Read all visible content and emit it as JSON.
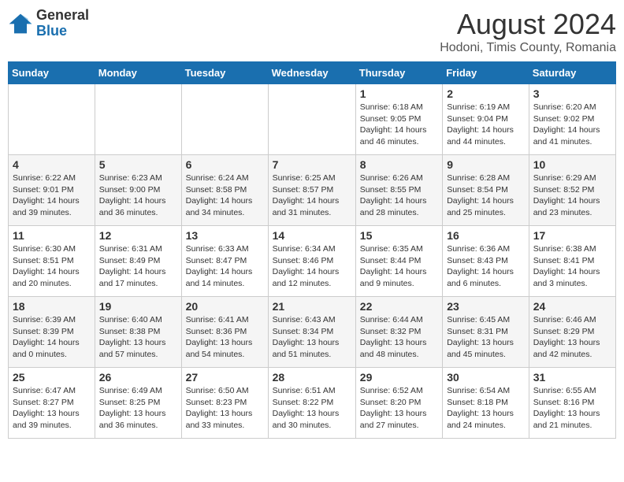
{
  "header": {
    "logo_general": "General",
    "logo_blue": "Blue",
    "month_year": "August 2024",
    "location": "Hodoni, Timis County, Romania"
  },
  "days_of_week": [
    "Sunday",
    "Monday",
    "Tuesday",
    "Wednesday",
    "Thursday",
    "Friday",
    "Saturday"
  ],
  "weeks": [
    [
      {
        "day": "",
        "info": ""
      },
      {
        "day": "",
        "info": ""
      },
      {
        "day": "",
        "info": ""
      },
      {
        "day": "",
        "info": ""
      },
      {
        "day": "1",
        "info": "Sunrise: 6:18 AM\nSunset: 9:05 PM\nDaylight: 14 hours\nand 46 minutes."
      },
      {
        "day": "2",
        "info": "Sunrise: 6:19 AM\nSunset: 9:04 PM\nDaylight: 14 hours\nand 44 minutes."
      },
      {
        "day": "3",
        "info": "Sunrise: 6:20 AM\nSunset: 9:02 PM\nDaylight: 14 hours\nand 41 minutes."
      }
    ],
    [
      {
        "day": "4",
        "info": "Sunrise: 6:22 AM\nSunset: 9:01 PM\nDaylight: 14 hours\nand 39 minutes."
      },
      {
        "day": "5",
        "info": "Sunrise: 6:23 AM\nSunset: 9:00 PM\nDaylight: 14 hours\nand 36 minutes."
      },
      {
        "day": "6",
        "info": "Sunrise: 6:24 AM\nSunset: 8:58 PM\nDaylight: 14 hours\nand 34 minutes."
      },
      {
        "day": "7",
        "info": "Sunrise: 6:25 AM\nSunset: 8:57 PM\nDaylight: 14 hours\nand 31 minutes."
      },
      {
        "day": "8",
        "info": "Sunrise: 6:26 AM\nSunset: 8:55 PM\nDaylight: 14 hours\nand 28 minutes."
      },
      {
        "day": "9",
        "info": "Sunrise: 6:28 AM\nSunset: 8:54 PM\nDaylight: 14 hours\nand 25 minutes."
      },
      {
        "day": "10",
        "info": "Sunrise: 6:29 AM\nSunset: 8:52 PM\nDaylight: 14 hours\nand 23 minutes."
      }
    ],
    [
      {
        "day": "11",
        "info": "Sunrise: 6:30 AM\nSunset: 8:51 PM\nDaylight: 14 hours\nand 20 minutes."
      },
      {
        "day": "12",
        "info": "Sunrise: 6:31 AM\nSunset: 8:49 PM\nDaylight: 14 hours\nand 17 minutes."
      },
      {
        "day": "13",
        "info": "Sunrise: 6:33 AM\nSunset: 8:47 PM\nDaylight: 14 hours\nand 14 minutes."
      },
      {
        "day": "14",
        "info": "Sunrise: 6:34 AM\nSunset: 8:46 PM\nDaylight: 14 hours\nand 12 minutes."
      },
      {
        "day": "15",
        "info": "Sunrise: 6:35 AM\nSunset: 8:44 PM\nDaylight: 14 hours\nand 9 minutes."
      },
      {
        "day": "16",
        "info": "Sunrise: 6:36 AM\nSunset: 8:43 PM\nDaylight: 14 hours\nand 6 minutes."
      },
      {
        "day": "17",
        "info": "Sunrise: 6:38 AM\nSunset: 8:41 PM\nDaylight: 14 hours\nand 3 minutes."
      }
    ],
    [
      {
        "day": "18",
        "info": "Sunrise: 6:39 AM\nSunset: 8:39 PM\nDaylight: 14 hours\nand 0 minutes."
      },
      {
        "day": "19",
        "info": "Sunrise: 6:40 AM\nSunset: 8:38 PM\nDaylight: 13 hours\nand 57 minutes."
      },
      {
        "day": "20",
        "info": "Sunrise: 6:41 AM\nSunset: 8:36 PM\nDaylight: 13 hours\nand 54 minutes."
      },
      {
        "day": "21",
        "info": "Sunrise: 6:43 AM\nSunset: 8:34 PM\nDaylight: 13 hours\nand 51 minutes."
      },
      {
        "day": "22",
        "info": "Sunrise: 6:44 AM\nSunset: 8:32 PM\nDaylight: 13 hours\nand 48 minutes."
      },
      {
        "day": "23",
        "info": "Sunrise: 6:45 AM\nSunset: 8:31 PM\nDaylight: 13 hours\nand 45 minutes."
      },
      {
        "day": "24",
        "info": "Sunrise: 6:46 AM\nSunset: 8:29 PM\nDaylight: 13 hours\nand 42 minutes."
      }
    ],
    [
      {
        "day": "25",
        "info": "Sunrise: 6:47 AM\nSunset: 8:27 PM\nDaylight: 13 hours\nand 39 minutes."
      },
      {
        "day": "26",
        "info": "Sunrise: 6:49 AM\nSunset: 8:25 PM\nDaylight: 13 hours\nand 36 minutes."
      },
      {
        "day": "27",
        "info": "Sunrise: 6:50 AM\nSunset: 8:23 PM\nDaylight: 13 hours\nand 33 minutes."
      },
      {
        "day": "28",
        "info": "Sunrise: 6:51 AM\nSunset: 8:22 PM\nDaylight: 13 hours\nand 30 minutes."
      },
      {
        "day": "29",
        "info": "Sunrise: 6:52 AM\nSunset: 8:20 PM\nDaylight: 13 hours\nand 27 minutes."
      },
      {
        "day": "30",
        "info": "Sunrise: 6:54 AM\nSunset: 8:18 PM\nDaylight: 13 hours\nand 24 minutes."
      },
      {
        "day": "31",
        "info": "Sunrise: 6:55 AM\nSunset: 8:16 PM\nDaylight: 13 hours\nand 21 minutes."
      }
    ]
  ]
}
